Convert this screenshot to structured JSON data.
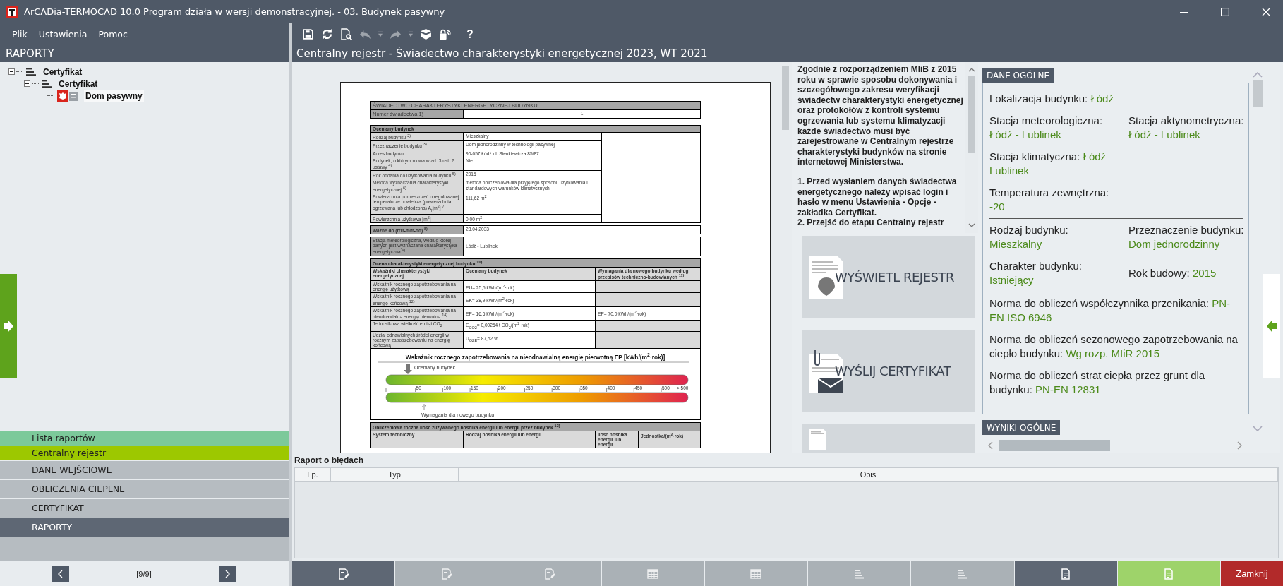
{
  "window": {
    "title": "ArCADia-TERMOCAD 10.0 Program działa w wersji demonstracyjnej. - 03. Budynek pasywny"
  },
  "menu": [
    {
      "label": "Plik"
    },
    {
      "label": "Ustawienia"
    },
    {
      "label": "Pomoc"
    }
  ],
  "toolbar": [
    {
      "kind": "save",
      "disabled": false
    },
    {
      "kind": "refresh",
      "disabled": false
    },
    {
      "kind": "preview",
      "disabled": false
    },
    {
      "kind": "undo",
      "disabled": true
    },
    {
      "kind": "dropdown",
      "disabled": true
    },
    {
      "kind": "redo",
      "disabled": true
    },
    {
      "kind": "dropdown",
      "disabled": true
    },
    {
      "kind": "box",
      "disabled": false
    },
    {
      "kind": "lock",
      "disabled": false
    },
    {
      "kind": "help",
      "label": "?",
      "disabled": false
    }
  ],
  "left_panel": {
    "title": "RAPORTY",
    "tree": [
      {
        "label": "Certyfikat",
        "kind": "group",
        "expanded": true,
        "selected": false,
        "children": [
          {
            "label": "Certyfikat",
            "kind": "group",
            "expanded": true,
            "selected": false,
            "children": [
              {
                "label": "Dom pasywny",
                "kind": "certificate",
                "selected": true
              }
            ]
          }
        ]
      }
    ],
    "reports": [
      {
        "label": "Lista raportów",
        "selected": false
      },
      {
        "label": "Centralny rejestr",
        "selected": true
      }
    ],
    "stages": [
      {
        "label": "DANE WEJŚCIOWE",
        "selected": false
      },
      {
        "label": "OBLICZENIA CIEPLNE",
        "selected": false
      },
      {
        "label": "CERTYFIKAT",
        "selected": false
      },
      {
        "label": "RAPORTY",
        "selected": true
      }
    ],
    "pager": "[9/9]"
  },
  "main_title": "Centralny rejestr - Świadectwo charakterystyki energetycznej 2023, WT 2021",
  "document": {
    "title": "ŚWIADECTWO CHARAKTERYSTYKI ENERGETYCZNEJ BUDYNKU",
    "number_label": "Numer świadectwa     1)",
    "number_value": "1",
    "building_heading": "Oceniany budynek",
    "building_rows": [
      {
        "label": "Rodzaj budynku $^{2)}$",
        "value": "Mieszkalny"
      },
      {
        "label": "Przeznaczenie budynku $^{3)}$",
        "value": "Dom jednorodzinny w technologii pasywnej"
      },
      {
        "label": "Adres budynku",
        "value": "90-057 Łódź ul. Sienkiewicza 85/87"
      },
      {
        "label": "Budynek, o którym mowa w art. 3 ust. 2 ustawy $^{4)}$",
        "value": "Nie"
      },
      {
        "label": "Rok oddania do użytkowania budynku $^{5)}$",
        "value": "2015"
      },
      {
        "label": "Metoda wyznaczania charakterystyki energetycznej $^{6)}$",
        "value": "metoda obliczeniowa dla przyjętego sposobu użytkowania i standardowych warunków klimatycznych"
      },
      {
        "label": "Powierzchnia pomieszczeń o regulowanej temperaturze powietrza (powierzchnia ogrzewana lub chłodzona) A$_{f}$[m$^{2}$] $^{7)}$",
        "value": "111,62 m$^{2}$"
      },
      {
        "label": "Powierzchnia użytkowa [m$^{2}$]",
        "value": "0,00 m$^{2}$"
      }
    ],
    "valid_label": "Ważne do (rrrr-mm-dd) $^{8)}$",
    "valid_value": "28.04.2033",
    "station_label": "Stacja meteorologiczna, według której danych jest wyznaczana charakterystyka energetyczna $^{9)}$",
    "station_value": "Łódź - Lublinek",
    "rating_heading": "Ocena charakterystyki energetycznej budynku $^{10)}$",
    "rating_columns": [
      "Wskaźniki charakterystyki energetycznej",
      "Oceniany budynek",
      "Wymagania dla nowego budynku według przepisów techniczno-budowlanych $^{11)}$"
    ],
    "rating_rows": [
      {
        "label": "Wskaźnik rocznego zapotrzebowania na energię użytkową",
        "value": "EU= 25,5 kWh/(m$^{2}$·rok)"
      },
      {
        "label": "Wskaźnik rocznego zapotrzebowania na energię końcową $^{12)}$",
        "value": "EK= 38,9 kWh/(m$^{2}$·rok)"
      },
      {
        "label": "Wskaźnik rocznego zapotrzebowania na nieodnawialną energię pierwotną $^{14)}$",
        "value": "EP= 16,6 kWh/(m$^{2}$·rok)",
        "requirement": "EP= 70,0 kWh/(m$^{2}$·rok)"
      },
      {
        "label": "Jednostkowa wielkość emisji CO$_{2}$",
        "value": "E$_{CO2}$= 0,00254 t CO$_{2}$/(m$^{2}$·rok)"
      },
      {
        "label": "Udział odnawialnych źródeł energii w rocznym zapotrzebowaniu na energię końcową",
        "value": "U$_{OZE}$= 87,52 %"
      }
    ],
    "scale": {
      "title": "Wskaźnik rocznego zapotrzebowania na nieodnawialną energię pierwotną EP [kWh/(m$^{2}$·rok)]",
      "assessed_label": "Oceniany budynek",
      "ticks": [
        "50",
        "100",
        "150",
        "200",
        "250",
        "300",
        "350",
        "400",
        "450",
        "500",
        "> 500"
      ],
      "required_label": "Wymagania dla nowego budynku"
    },
    "carrier_heading": "Obliczeniowa roczna ilość zużywanego nośnika energii lub energii przez budynek $^{13)}$",
    "carrier_columns": [
      "System techniczny",
      "Rodzaj nośnika energii lub energii",
      "Ilość nośnika energii lub energii",
      "Jednostka/(m$^{2}$·rok)"
    ]
  },
  "info_text": [
    "Zgodnie z rozporządzeniem MIiB z 2015 roku w sprawie sposobu dokonywania i szczegółowego zakresu weryfikacji świadectw charakterystyki energetycznej oraz protokołów z kontroli systemu ogrzewania lub systemu klimatyzacji każde świadectwo musi być zarejestrowane w Centralnym rejestrze charakterystyki budynków na stronie internetowej Ministerstwa.",
    "1. Przed wysłaniem danych świadectwa energetycznego należy wpisać login i hasło w menu  Ustawienia - Opcje - zakładka Certyfikat.",
    "2. Przejść do etapu Centralny rejestr"
  ],
  "actions": [
    {
      "kind": "register",
      "label": "WYŚWIETL REJESTR"
    },
    {
      "kind": "send",
      "label": "WYŚLIJ CERTYFIKAT"
    },
    {
      "kind": "report"
    }
  ],
  "general_data": {
    "title": "DANE OGÓLNE",
    "groups": [
      {
        "kind": "columns",
        "rows": [
          [
            {
              "label": "Lokalizacja budynku:",
              "value": "Łódź"
            }
          ],
          [
            {
              "label": "Stacja meteorologiczna:",
              "value": "Łódź - Lublinek"
            },
            {
              "label": "Stacja aktynometryczna:",
              "value": "Łódź - Lublinek"
            }
          ],
          [
            {
              "label": "Stacja klimatyczna:",
              "value": "Łódź Lublinek"
            }
          ],
          [
            {
              "label": "Temperatura zewnętrzna:",
              "value": "-20"
            }
          ]
        ]
      },
      {
        "kind": "columns",
        "rows": [
          [
            {
              "label": "Rodzaj budynku:",
              "value": "Mieszkalny"
            },
            {
              "label": "Przeznaczenie budynku:",
              "value": "Dom jednorodzinny"
            }
          ],
          [
            {
              "label": "Charakter budynku:",
              "value": "Istniejący"
            },
            {
              "label": "Rok budowy:",
              "value": "2015"
            }
          ]
        ]
      },
      {
        "kind": "stack",
        "rows": [
          [
            {
              "label": "Norma do obliczeń współczynnika przenikania:",
              "value": "PN-EN ISO 6946"
            }
          ],
          [
            {
              "label": "Norma do obliczeń sezonowego zapotrzebowania na ciepło budynku:",
              "value": "Wg rozp. MIiR 2015"
            }
          ],
          [
            {
              "label": "Norma do obliczeń strat ciepła przez grunt dla budynku:",
              "value": "PN-EN 12831"
            }
          ]
        ]
      }
    ]
  },
  "results_title": "WYNIKI OGÓLNE",
  "error_report": {
    "title": "Raport o błędach",
    "columns": [
      "Lp.",
      "Typ",
      "Opis"
    ]
  },
  "bottom_buttons": [
    {
      "kind": "edit",
      "disabled": false,
      "selected": false
    },
    {
      "kind": "edit",
      "disabled": true,
      "selected": false
    },
    {
      "kind": "edit",
      "disabled": true,
      "selected": false
    },
    {
      "kind": "table",
      "disabled": true,
      "selected": false
    },
    {
      "kind": "table",
      "disabled": true,
      "selected": false
    },
    {
      "kind": "list",
      "disabled": true,
      "selected": false
    },
    {
      "kind": "list",
      "disabled": true,
      "selected": false
    },
    {
      "kind": "document",
      "disabled": false,
      "selected": false
    },
    {
      "kind": "document",
      "disabled": false,
      "selected": true
    },
    {
      "kind": "close",
      "label": "Zamknij"
    }
  ]
}
